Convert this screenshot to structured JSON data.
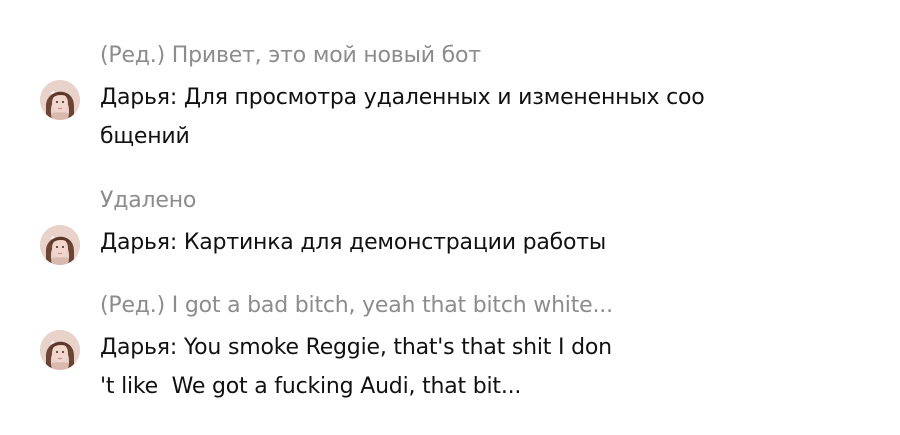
{
  "messages": [
    {
      "status": "(Ред.) Привет, это мой новый бот",
      "sender": "Дарья",
      "separator": ": ",
      "lines": [
        "Для просмотра удаленных и измененных соо",
        "бщений"
      ]
    },
    {
      "status": "Удалено",
      "sender": "Дарья",
      "separator": ": ",
      "lines": [
        "Картинка для демонстрации работы"
      ]
    },
    {
      "status": "(Ред.) I got a bad bitch, yeah that bitch white...",
      "sender": "Дарья",
      "separator": ": ",
      "lines": [
        "You smoke Reggie, that's that shit I don",
        "'t like  We got a fucking Audi, that bit..."
      ]
    }
  ],
  "colors": {
    "preview_text": "#8c8c8c",
    "message_text": "#111111",
    "background": "#ffffff"
  },
  "icons": {
    "avatar": "user-avatar-photo"
  }
}
